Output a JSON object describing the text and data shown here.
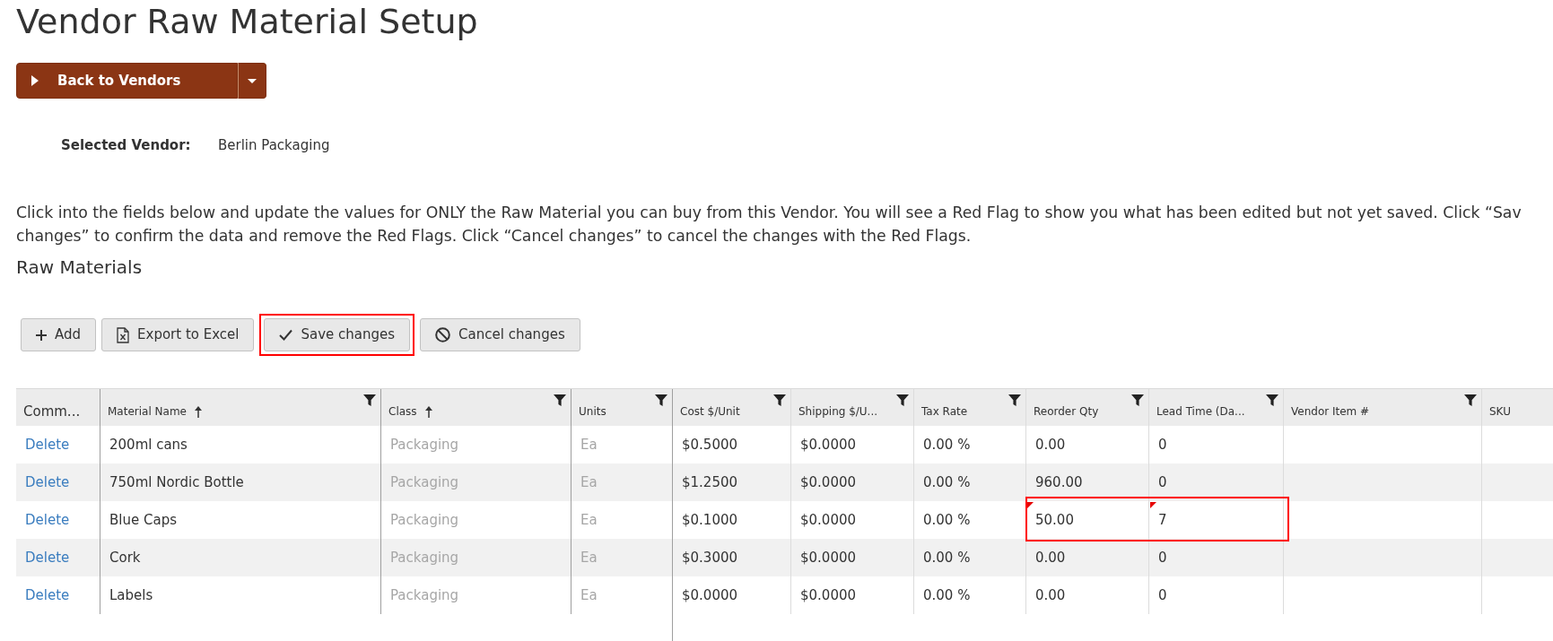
{
  "page": {
    "title": "Vendor Raw Material Setup"
  },
  "back_button": {
    "label": "Back to Vendors"
  },
  "selected_vendor": {
    "label": "Selected Vendor:",
    "value": "Berlin Packaging"
  },
  "instructions": [
    "Click into the fields below and update the values for ONLY the Raw Material you can buy from this Vendor. You will see a Red Flag to show you what has been edited but not yet saved. Click “Sav",
    "changes” to confirm the data and remove the Red Flags. Click “Cancel changes” to cancel the changes with the Red Flags."
  ],
  "section": {
    "title": "Raw Materials"
  },
  "toolbar": [
    {
      "kind": "add",
      "label": "Add",
      "highlighted": false
    },
    {
      "kind": "export",
      "label": "Export to Excel",
      "highlighted": false
    },
    {
      "kind": "save",
      "label": "Save changes",
      "highlighted": true
    },
    {
      "kind": "cancel",
      "label": "Cancel changes",
      "highlighted": false
    }
  ],
  "table": {
    "columns": [
      {
        "label": "Comm...",
        "kind": "command",
        "sorted": false,
        "filter": false
      },
      {
        "label": "Material Name",
        "kind": "text",
        "sorted": true,
        "filter": true
      },
      {
        "label": "Class",
        "kind": "readonly",
        "sorted": true,
        "filter": true
      },
      {
        "label": "Units",
        "kind": "readonly",
        "sorted": false,
        "filter": true
      },
      {
        "label": "Cost $/Unit",
        "kind": "text",
        "sorted": false,
        "filter": true
      },
      {
        "label": "Shipping $/U...",
        "kind": "text",
        "sorted": false,
        "filter": true
      },
      {
        "label": "Tax Rate",
        "kind": "text",
        "sorted": false,
        "filter": true
      },
      {
        "label": "Reorder Qty",
        "kind": "text",
        "sorted": false,
        "filter": true
      },
      {
        "label": "Lead Time (Da...",
        "kind": "text",
        "sorted": false,
        "filter": true
      },
      {
        "label": "Vendor Item #",
        "kind": "text",
        "sorted": false,
        "filter": true
      },
      {
        "label": "SKU",
        "kind": "text",
        "sorted": false,
        "filter": false
      }
    ],
    "rows": [
      {
        "cells": [
          {
            "text": "Delete",
            "edited": false,
            "highlighted": false
          },
          {
            "text": "200ml cans",
            "edited": false,
            "highlighted": false
          },
          {
            "text": "Packaging",
            "edited": false,
            "highlighted": false
          },
          {
            "text": "Ea",
            "edited": false,
            "highlighted": false
          },
          {
            "text": "$0.5000",
            "edited": false,
            "highlighted": false
          },
          {
            "text": "$0.0000",
            "edited": false,
            "highlighted": false
          },
          {
            "text": "0.00 %",
            "edited": false,
            "highlighted": false
          },
          {
            "text": "0.00",
            "edited": false,
            "highlighted": false
          },
          {
            "text": "0",
            "edited": false,
            "highlighted": false
          }
        ]
      },
      {
        "cells": [
          {
            "text": "Delete",
            "edited": false,
            "highlighted": false
          },
          {
            "text": "750ml Nordic Bottle",
            "edited": false,
            "highlighted": false
          },
          {
            "text": "Packaging",
            "edited": false,
            "highlighted": false
          },
          {
            "text": "Ea",
            "edited": false,
            "highlighted": false
          },
          {
            "text": "$1.2500",
            "edited": false,
            "highlighted": false
          },
          {
            "text": "$0.0000",
            "edited": false,
            "highlighted": false
          },
          {
            "text": "0.00 %",
            "edited": false,
            "highlighted": false
          },
          {
            "text": "960.00",
            "edited": false,
            "highlighted": false
          },
          {
            "text": "0",
            "edited": false,
            "highlighted": false
          }
        ]
      },
      {
        "cells": [
          {
            "text": "Delete",
            "edited": false,
            "highlighted": false
          },
          {
            "text": "Blue Caps",
            "edited": false,
            "highlighted": false
          },
          {
            "text": "Packaging",
            "edited": false,
            "highlighted": false
          },
          {
            "text": "Ea",
            "edited": false,
            "highlighted": false
          },
          {
            "text": "$0.1000",
            "edited": false,
            "highlighted": false
          },
          {
            "text": "$0.0000",
            "edited": false,
            "highlighted": false
          },
          {
            "text": "0.00 %",
            "edited": false,
            "highlighted": false
          },
          {
            "text": "50.00",
            "edited": true,
            "highlighted": true
          },
          {
            "text": "7",
            "edited": true,
            "highlighted": true
          }
        ]
      },
      {
        "cells": [
          {
            "text": "Delete",
            "edited": false,
            "highlighted": false
          },
          {
            "text": "Cork",
            "edited": false,
            "highlighted": false
          },
          {
            "text": "Packaging",
            "edited": false,
            "highlighted": false
          },
          {
            "text": "Ea",
            "edited": false,
            "highlighted": false
          },
          {
            "text": "$0.3000",
            "edited": false,
            "highlighted": false
          },
          {
            "text": "$0.0000",
            "edited": false,
            "highlighted": false
          },
          {
            "text": "0.00 %",
            "edited": false,
            "highlighted": false
          },
          {
            "text": "0.00",
            "edited": false,
            "highlighted": false
          },
          {
            "text": "0",
            "edited": false,
            "highlighted": false
          }
        ]
      },
      {
        "cells": [
          {
            "text": "Delete",
            "edited": false,
            "highlighted": false
          },
          {
            "text": "Labels",
            "edited": false,
            "highlighted": false
          },
          {
            "text": "Packaging",
            "edited": false,
            "highlighted": false
          },
          {
            "text": "Ea",
            "edited": false,
            "highlighted": false
          },
          {
            "text": "$0.0000",
            "edited": false,
            "highlighted": false
          },
          {
            "text": "$0.0000",
            "edited": false,
            "highlighted": false
          },
          {
            "text": "0.00 %",
            "edited": false,
            "highlighted": false
          },
          {
            "text": "0.00",
            "edited": false,
            "highlighted": false
          },
          {
            "text": "0",
            "edited": false,
            "highlighted": false
          }
        ]
      }
    ]
  }
}
